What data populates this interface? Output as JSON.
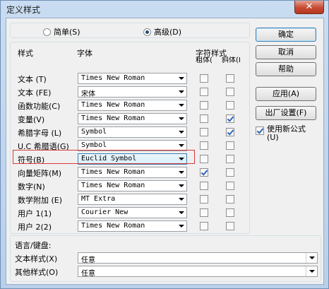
{
  "window": {
    "title": "定义样式",
    "close_label": "✕"
  },
  "mode": {
    "simple_label": "简单(S)",
    "advanced_label": "高级(D)",
    "selected": "advanced"
  },
  "headers": {
    "style": "样式",
    "font": "字体",
    "char_style": "字符样式",
    "bold": "粗体(B)",
    "italic": "斜体(I)"
  },
  "rows": [
    {
      "label": "文本 (T)",
      "font": "Times New Roman",
      "bold": false,
      "italic": false
    },
    {
      "label": "文本 (FE)",
      "font": "宋体",
      "bold": false,
      "italic": false
    },
    {
      "label": "函数功能(C)",
      "font": "Times New Roman",
      "bold": false,
      "italic": false
    },
    {
      "label": "变量(V)",
      "font": "Times New Roman",
      "bold": false,
      "italic": true
    },
    {
      "label": "希腊字母 (L)",
      "font": "Symbol",
      "bold": false,
      "italic": true
    },
    {
      "label": "U.C 希腊语(G)",
      "font": "Symbol",
      "bold": false,
      "italic": false
    },
    {
      "label": "符号(B)",
      "font": "Euclid Symbol",
      "bold": false,
      "italic": false
    },
    {
      "label": "向量矩阵(M)",
      "font": "Times New Roman",
      "bold": true,
      "italic": false
    },
    {
      "label": "数字(N)",
      "font": "Times New Roman",
      "bold": false,
      "italic": false
    },
    {
      "label": "数学附加 (E)",
      "font": "MT Extra",
      "bold": false,
      "italic": false
    },
    {
      "label": "用户 1(1)",
      "font": "Courier New",
      "bold": false,
      "italic": false
    },
    {
      "label": "用户 2(2)",
      "font": "Times New Roman",
      "bold": false,
      "italic": false
    }
  ],
  "language": {
    "title": "语言/键盘:",
    "text_style_label": "文本样式(X)",
    "text_style_value": "任意",
    "other_style_label": "其他样式(O)",
    "other_style_value": "任意"
  },
  "buttons": {
    "ok": "确定",
    "cancel": "取消",
    "help": "帮助",
    "apply": "应用(A)",
    "factory": "出厂设置(F)"
  },
  "use_new_formula": {
    "label": "使用新公式(U)",
    "checked": true
  },
  "colors": {
    "highlight": "#d83a3a",
    "accent": "#3c7fb1"
  }
}
